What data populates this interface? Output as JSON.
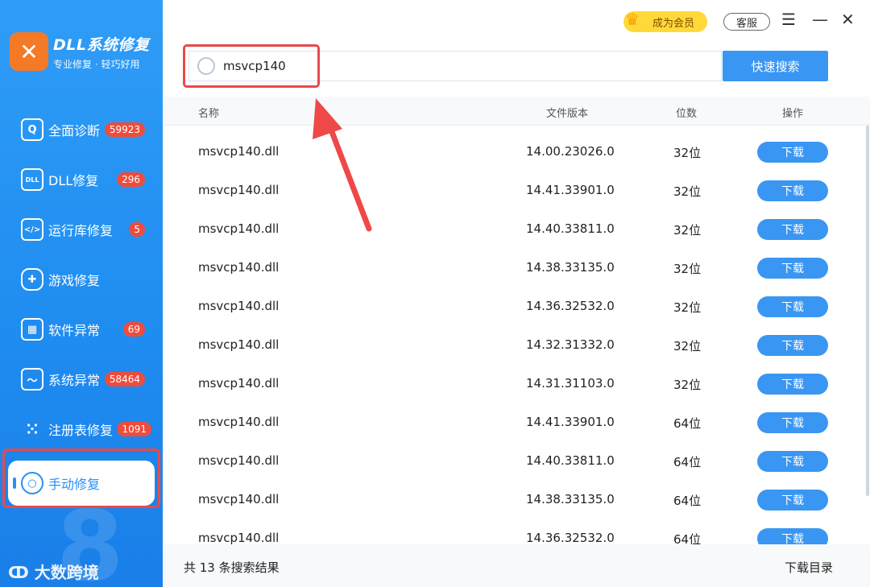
{
  "app": {
    "title": "DLL系统修复",
    "subtitle": "专业修复 · 轻巧好用"
  },
  "sidebar": {
    "items": [
      {
        "label": "全面诊断",
        "badge": "59923",
        "icon": "magnifier-icon"
      },
      {
        "label": "DLL修复",
        "badge": "296",
        "icon": "dll-file-icon"
      },
      {
        "label": "运行库修复",
        "badge": "5",
        "icon": "code-window-icon"
      },
      {
        "label": "游戏修复",
        "badge": "",
        "icon": "gamepad-icon"
      },
      {
        "label": "软件异常",
        "badge": "69",
        "icon": "app-grid-icon"
      },
      {
        "label": "系统异常",
        "badge": "58464",
        "icon": "monitor-icon"
      },
      {
        "label": "注册表修复",
        "badge": "1091",
        "icon": "registry-grid-icon"
      },
      {
        "label": "手动修复",
        "badge": "",
        "icon": "manual-search-icon",
        "active": true
      }
    ],
    "watermark": "大数跨境"
  },
  "topbar": {
    "vip_label": "成为会员",
    "service_label": "客服"
  },
  "search": {
    "value": "msvcp140",
    "button_label": "快速搜索"
  },
  "table": {
    "headers": {
      "name": "名称",
      "version": "文件版本",
      "bits": "位数",
      "action": "操作"
    },
    "rows": [
      {
        "name": "msvcp140.dll",
        "version": "14.00.23026.0",
        "bits": "32位",
        "action": "下载"
      },
      {
        "name": "msvcp140.dll",
        "version": "14.41.33901.0",
        "bits": "32位",
        "action": "下载"
      },
      {
        "name": "msvcp140.dll",
        "version": "14.40.33811.0",
        "bits": "32位",
        "action": "下载"
      },
      {
        "name": "msvcp140.dll",
        "version": "14.38.33135.0",
        "bits": "32位",
        "action": "下载"
      },
      {
        "name": "msvcp140.dll",
        "version": "14.36.32532.0",
        "bits": "32位",
        "action": "下载"
      },
      {
        "name": "msvcp140.dll",
        "version": "14.32.31332.0",
        "bits": "32位",
        "action": "下载"
      },
      {
        "name": "msvcp140.dll",
        "version": "14.31.31103.0",
        "bits": "32位",
        "action": "下载"
      },
      {
        "name": "msvcp140.dll",
        "version": "14.41.33901.0",
        "bits": "64位",
        "action": "下载"
      },
      {
        "name": "msvcp140.dll",
        "version": "14.40.33811.0",
        "bits": "64位",
        "action": "下载"
      },
      {
        "name": "msvcp140.dll",
        "version": "14.38.33135.0",
        "bits": "64位",
        "action": "下载"
      },
      {
        "name": "msvcp140.dll",
        "version": "14.36.32532.0",
        "bits": "64位",
        "action": "下载"
      }
    ]
  },
  "footer": {
    "result_text": "共 13 条搜索结果",
    "download_dir": "下载目录"
  },
  "colors": {
    "accent": "#3a96f3",
    "badge": "#ee4c3c",
    "highlight": "#e84a4a"
  }
}
